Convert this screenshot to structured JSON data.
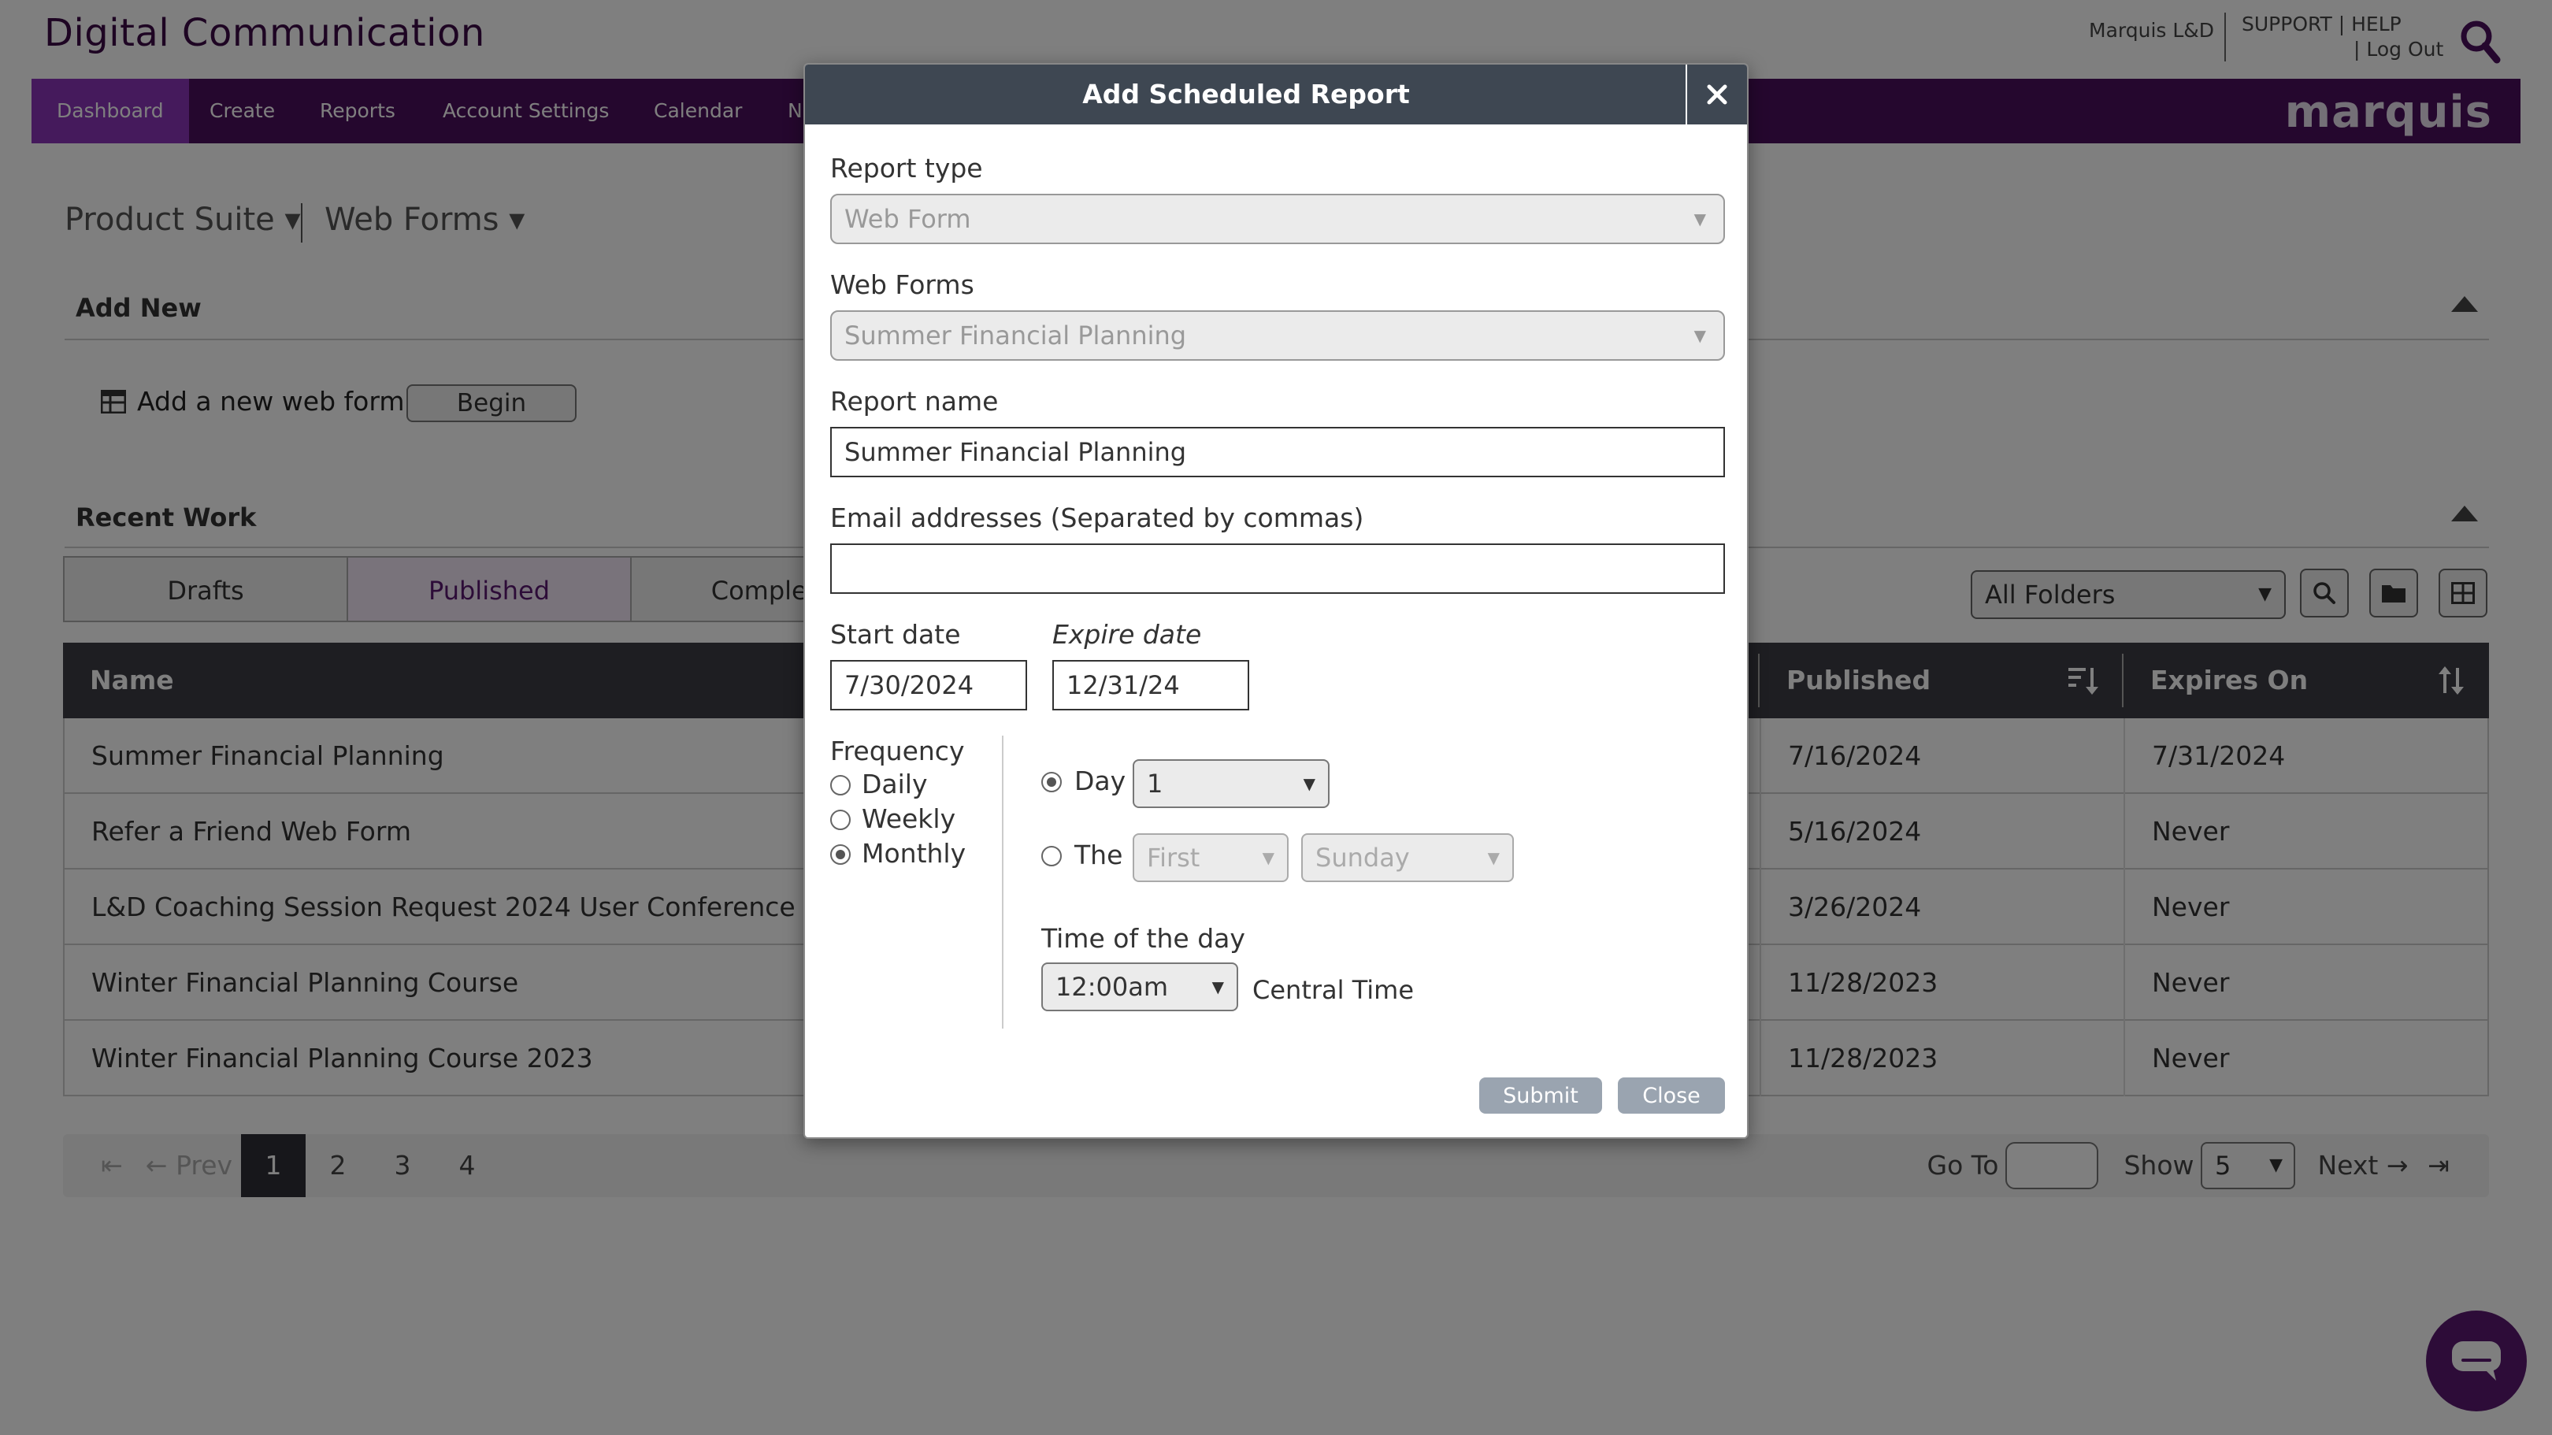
{
  "header": {
    "app_title": "Digital Communication",
    "user_name": "Marquis L&D",
    "support_links": "SUPPORT | HELP",
    "logout": "| Log Out"
  },
  "nav": {
    "items": [
      "Dashboard",
      "Create",
      "Reports",
      "Account Settings",
      "Calendar",
      "N"
    ],
    "logo": "marquis"
  },
  "main": {
    "suite_switch": "Product Suite ▾",
    "forms_switch": "Web Forms ▾",
    "add_new": {
      "title": "Add New",
      "add_label": "Add a new web form",
      "begin_label": "Begin"
    },
    "recent_work": {
      "title": "Recent Work",
      "tabs": [
        "Drafts",
        "Published",
        "Complet"
      ],
      "folder_select": "All Folders"
    },
    "table": {
      "headers": [
        "Name",
        "Published",
        "Expires On"
      ],
      "rows": [
        {
          "name": "Summer Financial Planning",
          "published": "7/16/2024",
          "expires": "7/31/2024"
        },
        {
          "name": "Refer a Friend Web Form",
          "published": "5/16/2024",
          "expires": "Never"
        },
        {
          "name": "L&D Coaching Session Request 2024 User Conference",
          "published": "3/26/2024",
          "expires": "Never"
        },
        {
          "name": "Winter Financial Planning Course",
          "published": "11/28/2023",
          "expires": "Never"
        },
        {
          "name": "Winter Financial Planning Course 2023",
          "published": "11/28/2023",
          "expires": "Never"
        }
      ]
    },
    "pager": {
      "prev": "Prev",
      "pages": [
        "1",
        "2",
        "3",
        "4"
      ],
      "goto_label": "Go To",
      "show_label": "Show",
      "show_value": "5",
      "next": "Next"
    }
  },
  "modal": {
    "title": "Add Scheduled Report",
    "report_type": {
      "label": "Report type",
      "value": "Web Form"
    },
    "web_forms": {
      "label": "Web Forms",
      "value": "Summer Financial Planning"
    },
    "report_name": {
      "label": "Report name",
      "value": "Summer Financial Planning"
    },
    "email": {
      "label": "Email addresses (Separated by commas)",
      "value": ""
    },
    "start_date": {
      "label": "Start date",
      "value": "7/30/2024"
    },
    "expire_date": {
      "label": "Expire date",
      "value": "12/31/24"
    },
    "frequency": {
      "label": "Frequency",
      "options": [
        "Daily",
        "Weekly",
        "Monthly"
      ],
      "selected": "Monthly"
    },
    "monthly": {
      "day_label": "Day",
      "day_value": "1",
      "the_label": "The",
      "ordinal_value": "First",
      "weekday_value": "Sunday",
      "selected": "Day"
    },
    "time": {
      "label": "Time of the day",
      "value": "12:00am",
      "zone": "Central Time"
    },
    "buttons": {
      "submit": "Submit",
      "close": "Close"
    }
  },
  "colors": {
    "brand_purple": "#4b0e5c",
    "nav_active": "#8b35b8",
    "modal_header": "#3e4752",
    "table_header": "#3c3c45"
  }
}
